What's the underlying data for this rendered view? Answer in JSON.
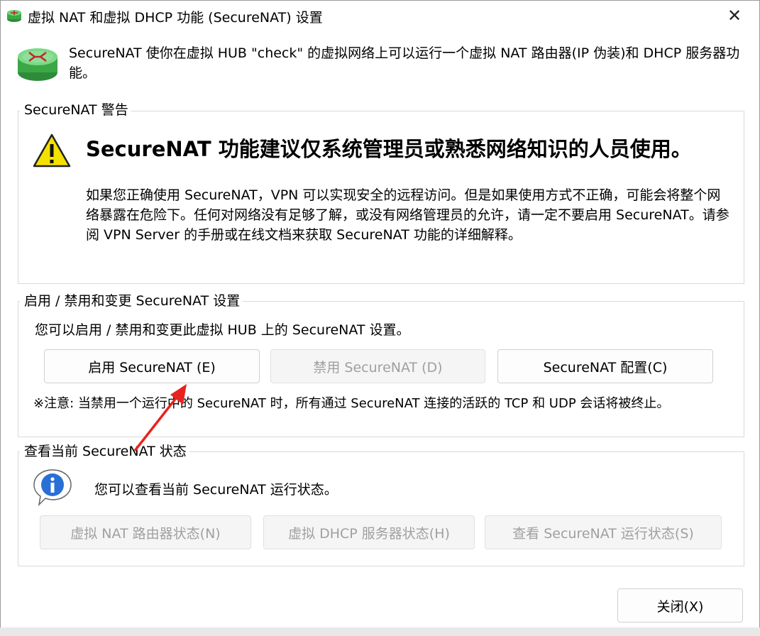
{
  "window": {
    "title": "虚拟 NAT 和虚拟 DHCP 功能 (SecureNAT) 设置",
    "close_glyph": "✕"
  },
  "intro": {
    "text": "SecureNAT 使你在虚拟 HUB \"check\" 的虚拟网络上可以运行一个虚拟 NAT 路由器(IP 伪装)和 DHCP 服务器功能。"
  },
  "warning_group": {
    "legend": "SecureNAT 警告",
    "title": "SecureNAT 功能建议仅系统管理员或熟悉网络知识的人员使用。",
    "body": "如果您正确使用 SecureNAT，VPN 可以实现安全的远程访问。但是如果使用方式不正确，可能会将整个网络暴露在危险下。任何对网络没有足够了解，或没有网络管理员的允许，请一定不要启用 SecureNAT。请参阅 VPN Server 的手册或在线文档来获取 SecureNAT 功能的详细解释。"
  },
  "control_group": {
    "legend": "启用 / 禁用和变更 SecureNAT 设置",
    "description": "您可以启用 / 禁用和变更此虚拟 HUB 上的 SecureNAT 设置。",
    "enable_button": "启用 SecureNAT (E)",
    "disable_button": "禁用 SecureNAT (D)",
    "config_button": "SecureNAT 配置(C)",
    "note": "※注意: 当禁用一个运行中的 SecureNAT 时，所有通过 SecureNAT 连接的活跃的 TCP 和 UDP 会话将被终止。"
  },
  "status_group": {
    "legend": "查看当前 SecureNAT 状态",
    "description": "您可以查看当前 SecureNAT 运行状态。",
    "nat_status_button": "虚拟 NAT 路由器状态(N)",
    "dhcp_status_button": "虚拟 DHCP 服务器状态(H)",
    "securenat_status_button": "查看 SecureNAT 运行状态(S)"
  },
  "footer": {
    "close_button": "关闭(X)"
  },
  "colors": {
    "annotation_arrow": "#e8231f",
    "router_icon": "#3aa845",
    "warning_icon": "#f5e100",
    "info_icon": "#2a6fd6"
  },
  "icons": {
    "title": "router-icon",
    "intro": "router-icon",
    "warning": "warning-icon",
    "info": "info-icon"
  }
}
